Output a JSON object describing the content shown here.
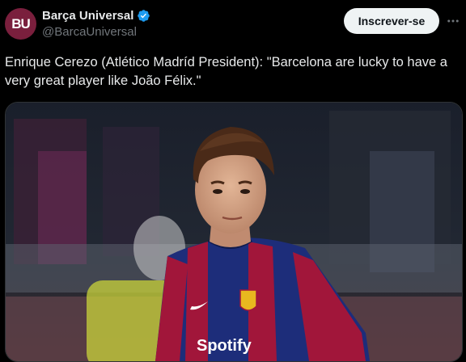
{
  "tweet": {
    "author": {
      "avatar_text": "BU",
      "display_name": "Barça Universal",
      "handle": "@BarcaUniversal",
      "verified_icon": "verified-badge-icon"
    },
    "follow_label": "Inscrever-se",
    "more_icon": "ellipsis-icon",
    "text": "Enrique Cerezo (Atlético Madríd President): \"Barcelona are lucky to have a very great player like João Félix.\"",
    "media": {
      "shirt_sponsor": "Spotify"
    }
  },
  "colors": {
    "background": "#000000",
    "text": "#e7e9ea",
    "secondary_text": "#71767b",
    "verified": "#1d9bf0",
    "avatar_bg": "#7a1f3d",
    "follow_bg": "#eff3f4"
  }
}
